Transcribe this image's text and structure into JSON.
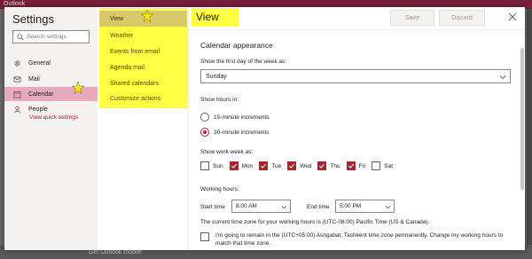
{
  "background": {
    "brand": "Outlook",
    "bottom_hint": "Get Outlook mobile"
  },
  "settings": {
    "title": "Settings",
    "search_placeholder": "Search settings",
    "nav": [
      {
        "label": "General",
        "icon": "gear-icon"
      },
      {
        "label": "Mail",
        "icon": "mail-icon"
      },
      {
        "label": "Calendar",
        "icon": "calendar-icon"
      },
      {
        "label": "People",
        "icon": "person-icon"
      }
    ],
    "view_quick_settings": "View quick settings"
  },
  "categories": [
    "View",
    "Weather",
    "Events from email",
    "Agenda mail",
    "Shared calendars",
    "Customize actions"
  ],
  "content": {
    "title": "View",
    "save_label": "Save",
    "discard_label": "Discard",
    "section_title": "Calendar appearance",
    "first_day_label": "Show the first day of the week as:",
    "first_day_value": "Sunday",
    "hours_label": "Show hours in:",
    "radio_15": "15-minute increments",
    "radio_30": "30-minute increments",
    "selected_increment": "30-minute increments",
    "work_week_label": "Show work week as:",
    "days": [
      {
        "label": "Sun",
        "checked": false
      },
      {
        "label": "Mon",
        "checked": true
      },
      {
        "label": "Tue",
        "checked": true
      },
      {
        "label": "Wed",
        "checked": true
      },
      {
        "label": "Thu",
        "checked": true
      },
      {
        "label": "Fri",
        "checked": true
      },
      {
        "label": "Sat",
        "checked": false
      }
    ],
    "working_hours_label": "Working hours:",
    "start_time_label": "Start time",
    "start_time_value": "8:00 AM",
    "end_time_label": "End time",
    "end_time_value": "5:00 PM",
    "tz_text": "The current time zone for your working hours is (UTC-08:00) Pacific Time (US & Canada).",
    "tz_checkbox_text": "I'm going to remain in the (UTC+05:00) Ashgabat, Tashkent time zone permanently. Change my working hours to match that time zone."
  },
  "colors": {
    "accent": "#a4262c",
    "highlight": "#ffff44",
    "active_nav": "#e8a8bd"
  }
}
